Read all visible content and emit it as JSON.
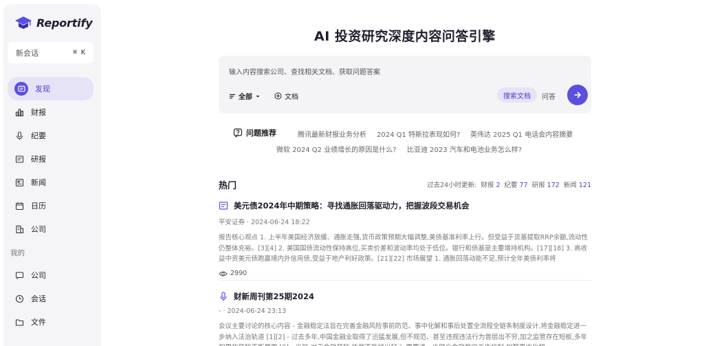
{
  "app": {
    "name": "Reportify"
  },
  "sidebar": {
    "new_chat_label": "新会话",
    "new_chat_shortcut": "⌘ K",
    "items": [
      {
        "label": "发现",
        "icon": "discover-icon"
      },
      {
        "label": "财报",
        "icon": "bar-chart-icon"
      },
      {
        "label": "纪要",
        "icon": "microphone-icon"
      },
      {
        "label": "研报",
        "icon": "report-icon"
      },
      {
        "label": "新闻",
        "icon": "news-icon"
      },
      {
        "label": "日历",
        "icon": "calendar-icon"
      },
      {
        "label": "公司",
        "icon": "building-icon"
      }
    ],
    "mine_label": "我的",
    "mine_items": [
      {
        "label": "公司",
        "icon": "flag-icon"
      },
      {
        "label": "会话",
        "icon": "clock-icon"
      },
      {
        "label": "文件",
        "icon": "folder-icon"
      }
    ]
  },
  "main": {
    "title": "AI 投资研究深度内容问答引擎",
    "search": {
      "placeholder": "输入内容搜索公司、查找相关文档、获取问题答案",
      "scope_label": "全部",
      "doc_label": "文档",
      "mode_search": "搜索文档",
      "mode_qa": "问答"
    },
    "recommend": {
      "label": "问题推荐",
      "items": [
        "腾讯最新财报业务分析",
        "2024 Q1 特斯拉表现如何?",
        "英伟达 2025 Q1 电话会内容摘要",
        "微软 2024 Q2 业绩增长的原因是什么?",
        "比亚迪 2023 汽车和电池业务怎么样?"
      ]
    },
    "hot": {
      "title": "热门",
      "updates_label": "过去24小时更新:",
      "updates": [
        {
          "label": "财报",
          "count": "2"
        },
        {
          "label": "纪要",
          "count": "77"
        },
        {
          "label": "研报",
          "count": "172"
        },
        {
          "label": "新闻",
          "count": "121"
        }
      ]
    },
    "articles": [
      {
        "title": "美元债2024年中期策略：寻找通胀回落驱动力，把握波段交易机会",
        "source": "平安证券",
        "time": "2024-06-24 18:22",
        "body": "报告核心观点 1. 上半年美国经济放缓、通胀走强,货币政策预期大幅调整,美债基准利率上行。但受益于货基提取RRP余额,流动性仍整体充裕。[3][4] 2. 美国国债流动性保持高位,买卖价差和波动率均处于低位。银行和债基是主要增持机构。[17][18] 3. 高收益中资美元债跑赢境内外信用债,受益于地产利好政策。[21][22] 市场展望 1. 通胀回落动能不足,预计全年美债利率将",
        "views": "2990"
      },
      {
        "title": "财新周刊第25期2024",
        "source": "-",
        "time": "2024-06-24 23:13",
        "body": "会议主要讨论的核心内容 - 金融稳定法旨在完善金融风险事前防范、事中化解和事后处置全流程全链条制度设计,将金融稳定进一步纳入法治轨道 [1][2] - 过去多年,中国金融业取得了迅猛发展,但不规范、甚至违规违法行为曾层出不穷,加之监管存在短板,多年积累的风险不断暴露 [2] - 当前,对于金融风险,依然不能掉以轻心,需要进一步健全金融稳定工作机制,加强事中化解,",
        "views": ""
      }
    ]
  },
  "colors": {
    "accent": "#5b4fe0",
    "accent_soft": "#e6e3f7"
  }
}
